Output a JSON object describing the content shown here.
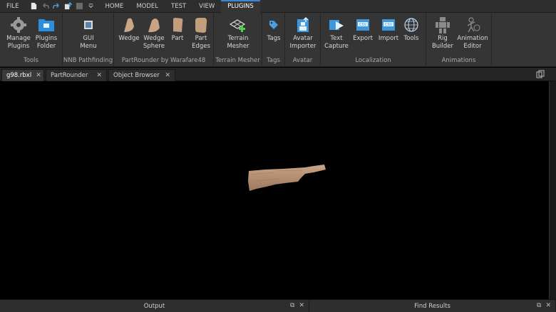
{
  "menubar": {
    "file": "FILE",
    "tabs": [
      "HOME",
      "MODEL",
      "TEST",
      "VIEW",
      "PLUGINS"
    ],
    "active_tab": "PLUGINS"
  },
  "ribbon": {
    "groups": {
      "tools": {
        "label": "Tools",
        "items": [
          {
            "label": "Manage\nPlugins",
            "icon": "gear-icon"
          },
          {
            "label": "Plugins\nFolder",
            "icon": "folder-icon"
          }
        ]
      },
      "nnb": {
        "label": "NNB Pathfinding",
        "items": [
          {
            "label": "GUI\nMenu",
            "icon": "gui-menu-icon"
          }
        ]
      },
      "partrounder": {
        "label": "PartRounder by Warafare48",
        "items": [
          {
            "label": "Wedge",
            "icon": "wedge-icon"
          },
          {
            "label": "Wedge\nSphere",
            "icon": "wedge-sphere-icon"
          },
          {
            "label": "Part",
            "icon": "part-icon"
          },
          {
            "label": "Part\nEdges",
            "icon": "part-edges-icon"
          }
        ]
      },
      "terrain": {
        "label": "Terrain Mesher",
        "items": [
          {
            "label": "Terrain\nMesher",
            "icon": "terrain-mesher-icon"
          }
        ]
      },
      "tags": {
        "label": "Tags",
        "items": [
          {
            "label": "Tags",
            "icon": "tag-icon"
          }
        ]
      },
      "avatar": {
        "label": "Avatar",
        "items": [
          {
            "label": "Avatar\nImporter",
            "icon": "avatar-importer-icon"
          }
        ]
      },
      "localization": {
        "label": "Localization",
        "items": [
          {
            "label": "Text\nCapture",
            "icon": "text-capture-icon"
          },
          {
            "label": "Export",
            "icon": "csv-export-icon"
          },
          {
            "label": "Import",
            "icon": "csv-import-icon"
          },
          {
            "label": "Tools",
            "icon": "globe-icon"
          }
        ]
      },
      "animations": {
        "label": "Animations",
        "items": [
          {
            "label": "Rig\nBuilder",
            "icon": "rig-builder-icon"
          },
          {
            "label": "Animation\nEditor",
            "icon": "animation-editor-icon"
          }
        ]
      }
    }
  },
  "doc_tabs": [
    {
      "label": "g98.rbxl",
      "active": true
    },
    {
      "label": "PartRounder",
      "active": false
    },
    {
      "label": "Object Browser",
      "active": false
    }
  ],
  "bottom_panels": {
    "output": "Output",
    "find_results": "Find Results"
  },
  "colors": {
    "accent": "#3a86d4",
    "ribbon_bg": "#353535",
    "menubar_bg": "#2e2e2e",
    "viewport_bg": "#000000",
    "wood": "#b48e72"
  }
}
